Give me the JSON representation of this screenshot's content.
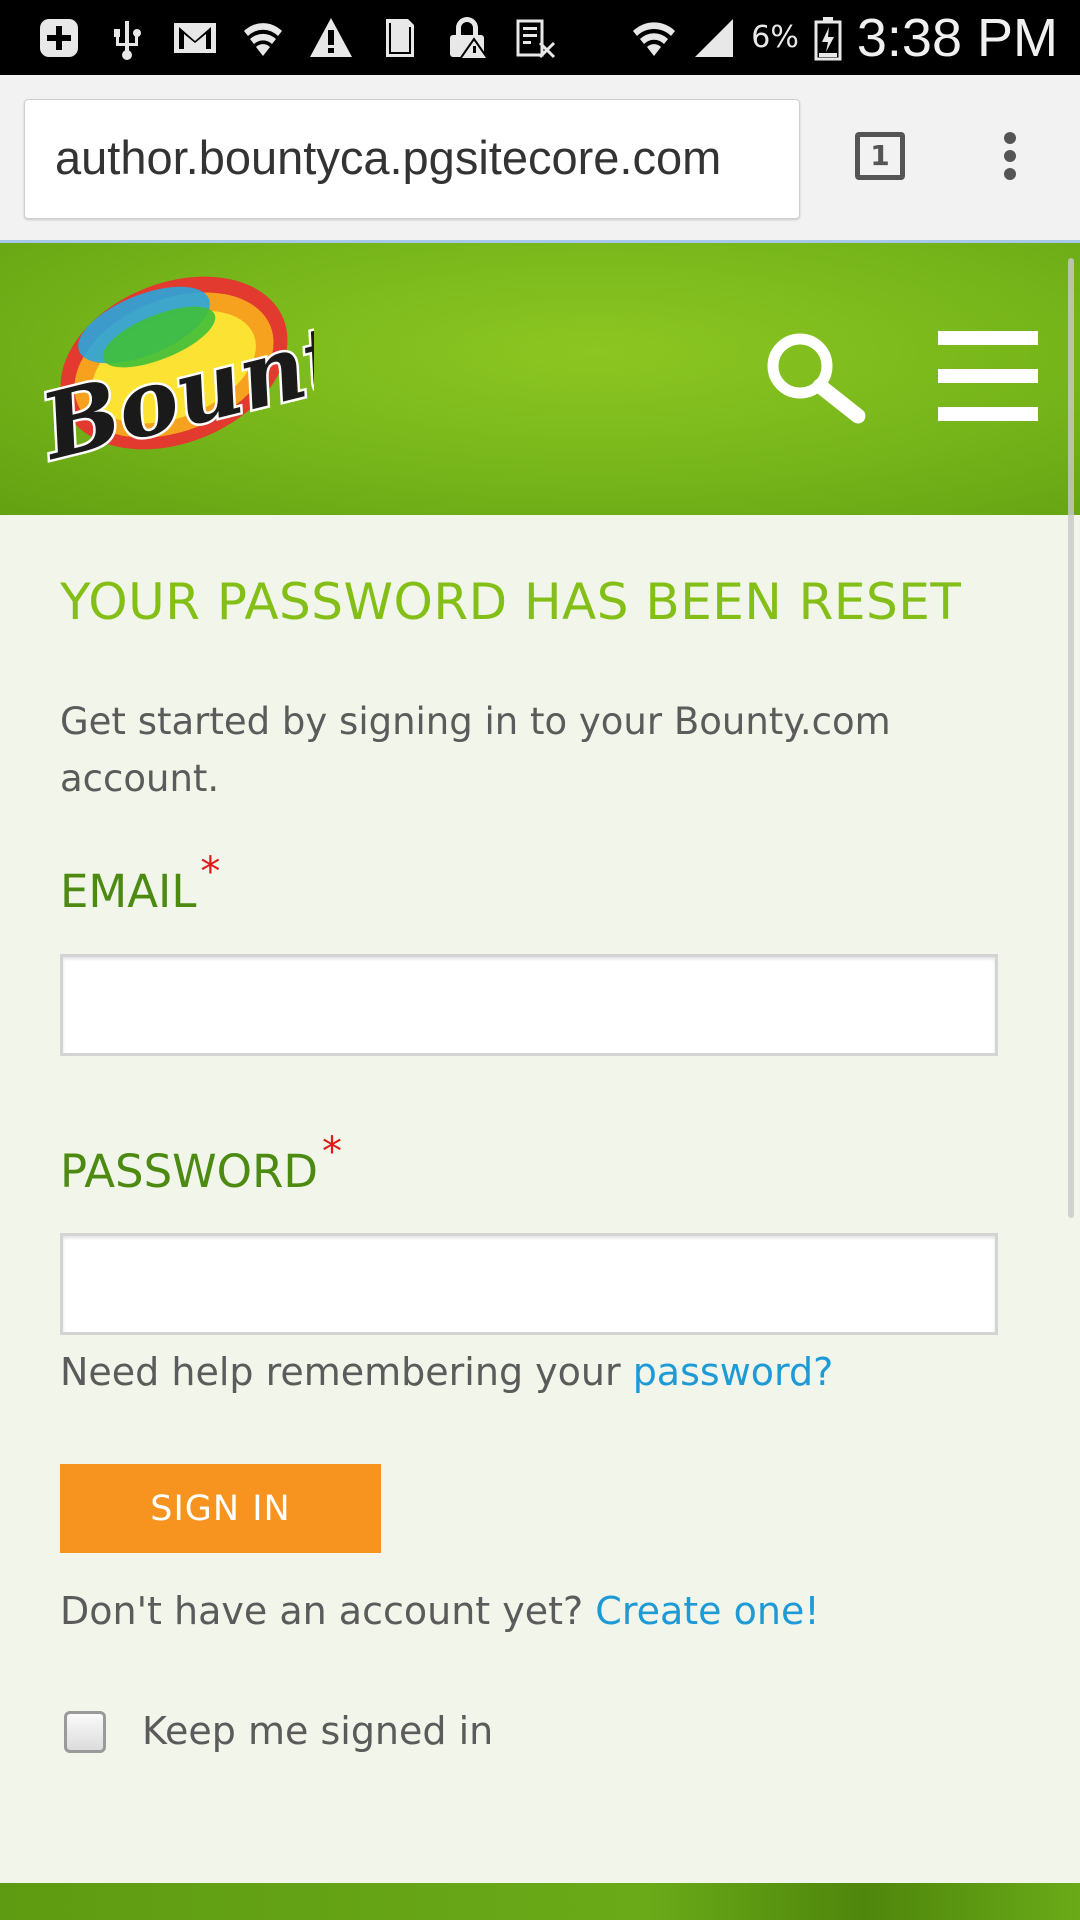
{
  "status_bar": {
    "battery_percent": "6%",
    "time": "3:38 PM",
    "icons": [
      "plus-icon",
      "usb-icon",
      "gmail-icon",
      "wifi-hotspot-icon",
      "warning-icon",
      "sim-card-icon",
      "lock-alert-icon",
      "no-data-icon",
      "wifi-icon",
      "signal-icon",
      "battery-icon"
    ]
  },
  "browser": {
    "url": "author.bountyca.pgsitecore.com",
    "tab_count": "1"
  },
  "header": {
    "logo_text": "Bounty",
    "brand_color": "#76b51a"
  },
  "main": {
    "title": "YOUR PASSWORD HAS BEEN RESET",
    "intro": "Get started by signing in to your Bounty.com account.",
    "email_label": "EMAIL",
    "email_value": "",
    "password_label": "PASSWORD",
    "password_value": "",
    "required_marker": "*",
    "help_prefix": "Need help remembering your",
    "help_link": "password?",
    "signin_label": "SIGN IN",
    "create_prefix": "Don't have an account yet?",
    "create_link": "Create one!",
    "keep_signed_in_label": "Keep me signed in",
    "accent_color": "#84bf17",
    "button_color": "#f7931f",
    "link_color": "#1e9ad6"
  }
}
